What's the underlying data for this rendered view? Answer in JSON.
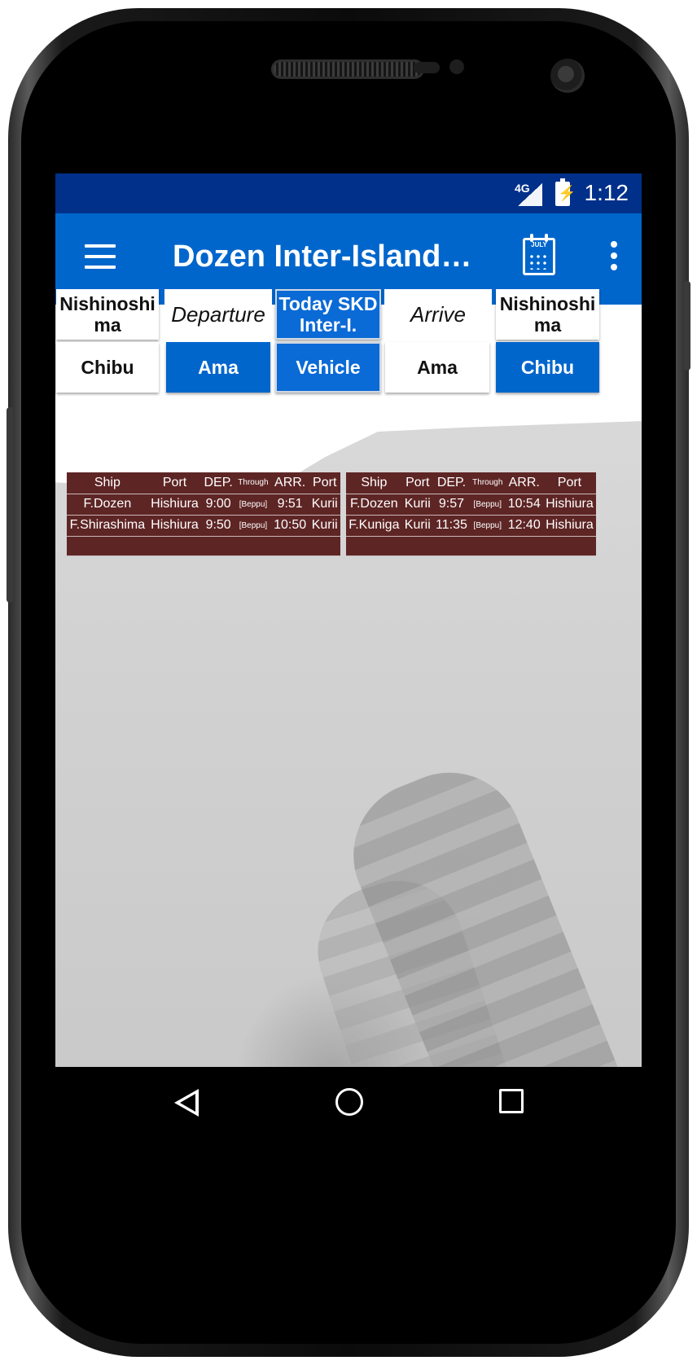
{
  "status_bar": {
    "network": "4G",
    "time": "1:12"
  },
  "app_bar": {
    "title": "Dozen Inter-Islands…",
    "calendar_icon_text": "JULY"
  },
  "selector": {
    "row1": [
      {
        "label": "Nishinoshi ma",
        "style": "white"
      },
      {
        "label": "Departure",
        "style": "label"
      },
      {
        "label": "Today SKD Inter-I.",
        "style": "blue"
      },
      {
        "label": "Arrive",
        "style": "label"
      },
      {
        "label": "Nishinoshi ma",
        "style": "white"
      }
    ],
    "row2": [
      {
        "label": "Chibu",
        "style": "white"
      },
      {
        "label": "Ama",
        "style": "blue"
      },
      {
        "label": "Vehicle",
        "style": "blue"
      },
      {
        "label": "Ama",
        "style": "white"
      },
      {
        "label": "Chibu",
        "style": "blue"
      }
    ]
  },
  "timetable_left": {
    "headers": [
      "Ship",
      "Port",
      "DEP.",
      "Through",
      "ARR.",
      "Port"
    ],
    "rows": [
      [
        "F.Dozen",
        "Hishiura",
        "9:00",
        "[Beppu]",
        "9:51",
        "Kurii"
      ],
      [
        "F.Shirashima",
        "Hishiura",
        "9:50",
        "[Beppu]",
        "10:50",
        "Kurii"
      ]
    ]
  },
  "timetable_right": {
    "headers": [
      "Ship",
      "Port",
      "DEP.",
      "Through",
      "ARR.",
      "Port"
    ],
    "rows": [
      [
        "F.Dozen",
        "Kurii",
        "9:57",
        "[Beppu]",
        "10:54",
        "Hishiura"
      ],
      [
        "F.Kuniga",
        "Kurii",
        "11:35",
        "[Beppu]",
        "12:40",
        "Hishiura"
      ]
    ]
  },
  "colors": {
    "status_bar": "#00308a",
    "app_bar": "#0066cc",
    "button_blue": "#0066cc",
    "table_bg": "#5e2525"
  }
}
